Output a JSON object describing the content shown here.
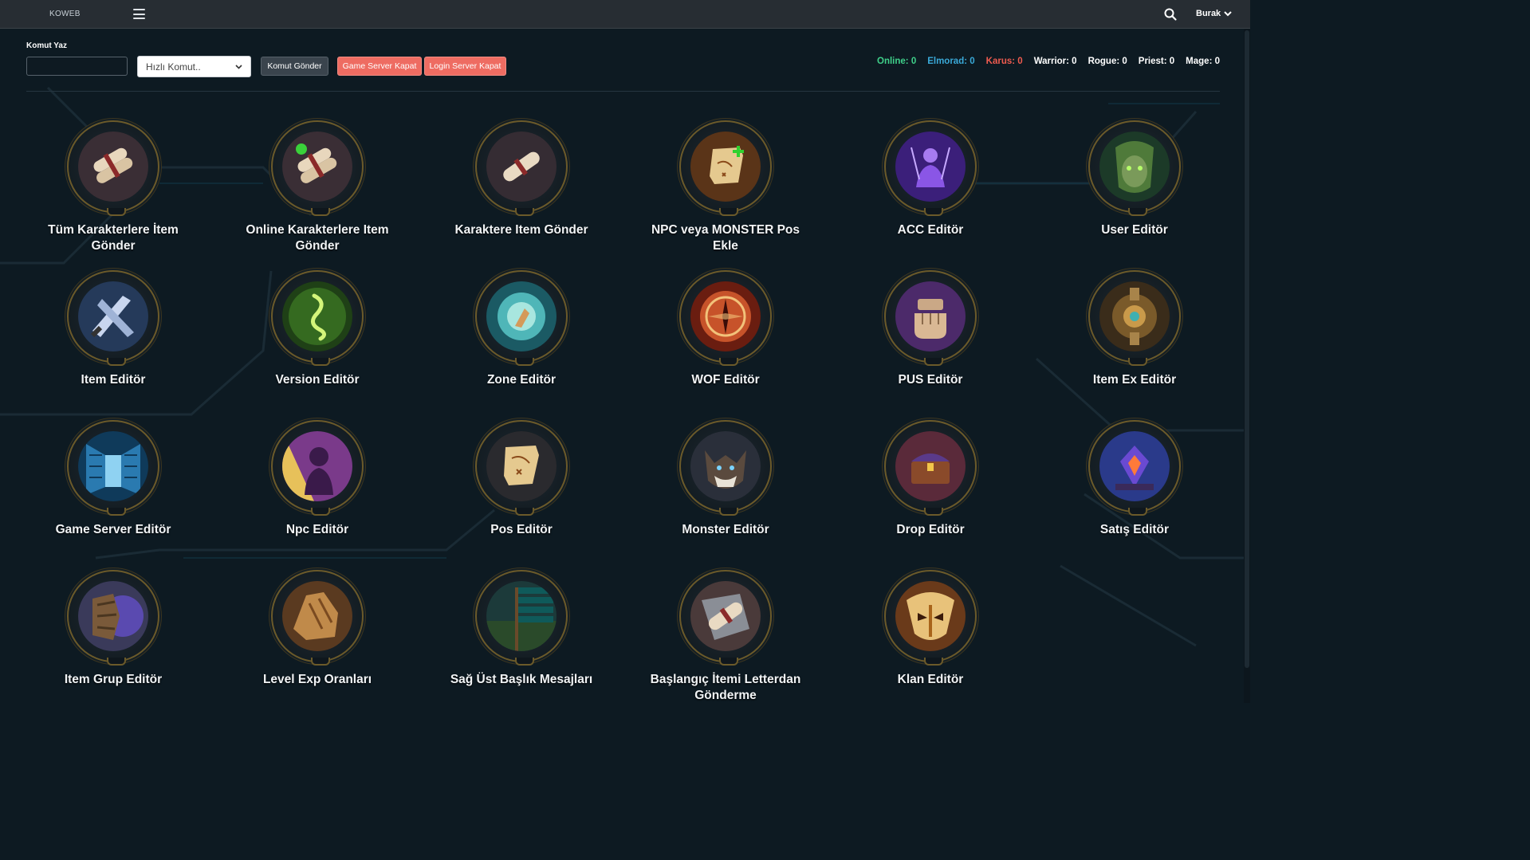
{
  "topbar": {
    "brand": "KOWEB",
    "user": "Burak"
  },
  "command": {
    "label": "Komut Yaz",
    "input_value": "",
    "quick_select": "Hızlı Komut..",
    "send_label": "Komut Gönder",
    "game_close_label": "Game Server Kapat",
    "login_close_label": "Login Server Kapat"
  },
  "stats": [
    {
      "label": "Online: 0",
      "color": "#3fd08a"
    },
    {
      "label": "Elmorad: 0",
      "color": "#3aa9d8"
    },
    {
      "label": "Karus: 0",
      "color": "#ef5b4f"
    },
    {
      "label": "Warrior: 0",
      "color": "#ffffff"
    },
    {
      "label": "Rogue: 0",
      "color": "#ffffff"
    },
    {
      "label": "Priest: 0",
      "color": "#ffffff"
    },
    {
      "label": "Mage: 0",
      "color": "#ffffff"
    }
  ],
  "tiles": [
    {
      "label": "Tüm Karakterlere İtem Gönder",
      "icon": "scrolls-icon"
    },
    {
      "label": "Online Karakterlere Item Gönder",
      "icon": "scrolls-online-icon"
    },
    {
      "label": "Karaktere Item Gönder",
      "icon": "scroll-icon"
    },
    {
      "label": "NPC veya MONSTER Pos Ekle",
      "icon": "map-plus-icon"
    },
    {
      "label": "ACC Editör",
      "icon": "purple-figure-icon"
    },
    {
      "label": "User Editör",
      "icon": "user-face-icon"
    },
    {
      "label": "Item Editör",
      "icon": "swords-icon"
    },
    {
      "label": "Version Editör",
      "icon": "green-rune-icon"
    },
    {
      "label": "Zone Editör",
      "icon": "cyan-portal-icon"
    },
    {
      "label": "WOF Editör",
      "icon": "fire-emblem-icon"
    },
    {
      "label": "PUS Editör",
      "icon": "fist-icon"
    },
    {
      "label": "Item Ex Editör",
      "icon": "gear-icon"
    },
    {
      "label": "Game Server Editör",
      "icon": "server-room-icon"
    },
    {
      "label": "Npc Editör",
      "icon": "npc-silhouette-icon"
    },
    {
      "label": "Pos Editör",
      "icon": "map-icon"
    },
    {
      "label": "Monster Editör",
      "icon": "wolf-icon"
    },
    {
      "label": "Drop Editör",
      "icon": "chest-icon"
    },
    {
      "label": "Satış Editör",
      "icon": "shop-crystal-icon"
    },
    {
      "label": "Item Grup Editör",
      "icon": "shield-group-icon"
    },
    {
      "label": "Level Exp Oranları",
      "icon": "rock-hand-icon"
    },
    {
      "label": "Sağ Üst Başlık Mesajları",
      "icon": "signpost-icon"
    },
    {
      "label": "Başlangıç İtemi Letterdan Gönderme",
      "icon": "letter-shield-icon"
    },
    {
      "label": "Klan Editör",
      "icon": "clan-mask-icon"
    }
  ]
}
